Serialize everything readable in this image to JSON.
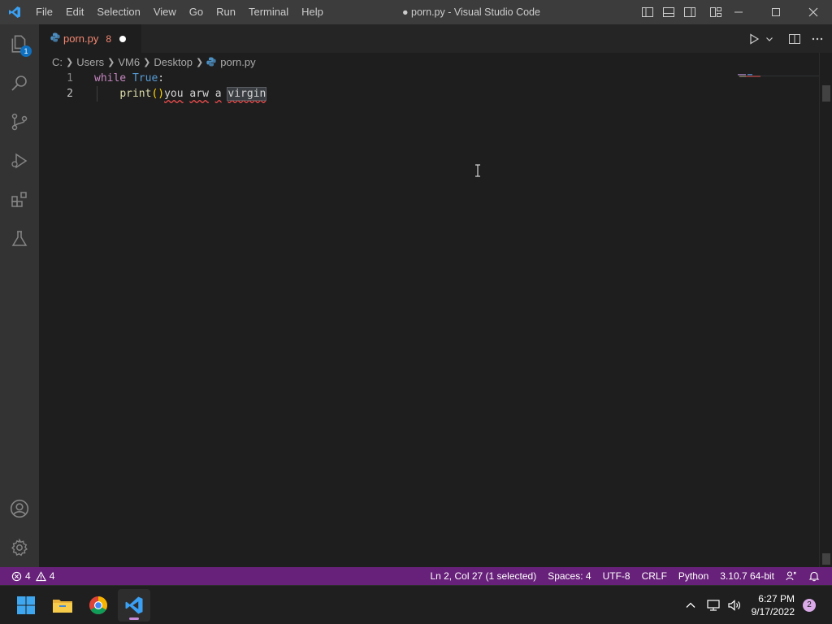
{
  "window": {
    "title": "● porn.py - Visual Studio Code"
  },
  "menu": [
    "File",
    "Edit",
    "Selection",
    "View",
    "Go",
    "Run",
    "Terminal",
    "Help"
  ],
  "activity": {
    "explorer_badge": "1"
  },
  "tab": {
    "label": "porn.py",
    "problem_count": "8"
  },
  "breadcrumb": [
    "C:",
    "Users",
    "VM6",
    "Desktop",
    "porn.py"
  ],
  "editor": {
    "line_numbers": [
      "1",
      "2"
    ],
    "line1": {
      "kw": "while",
      "const": "True",
      "colon": ":"
    },
    "line2": {
      "indent": "    ",
      "fn": "print",
      "open": "(",
      "close": ")",
      "w1": "you",
      "sp1": " ",
      "w2": "arw",
      "sp2": " ",
      "w3": "a",
      "sp3": " ",
      "w4": "virgin"
    }
  },
  "status": {
    "errors": "4",
    "warnings": "4",
    "position": "Ln 2, Col 27 (1 selected)",
    "spaces": "Spaces: 4",
    "encoding": "UTF-8",
    "eol": "CRLF",
    "language": "Python",
    "interpreter": "3.10.7 64-bit"
  },
  "taskbar": {
    "time": "6:27 PM",
    "date": "9/17/2022",
    "notifications": "2"
  },
  "colors": {
    "statusbar": "#68217a",
    "accent": "#0e70c0",
    "tab_error": "#f48771"
  }
}
